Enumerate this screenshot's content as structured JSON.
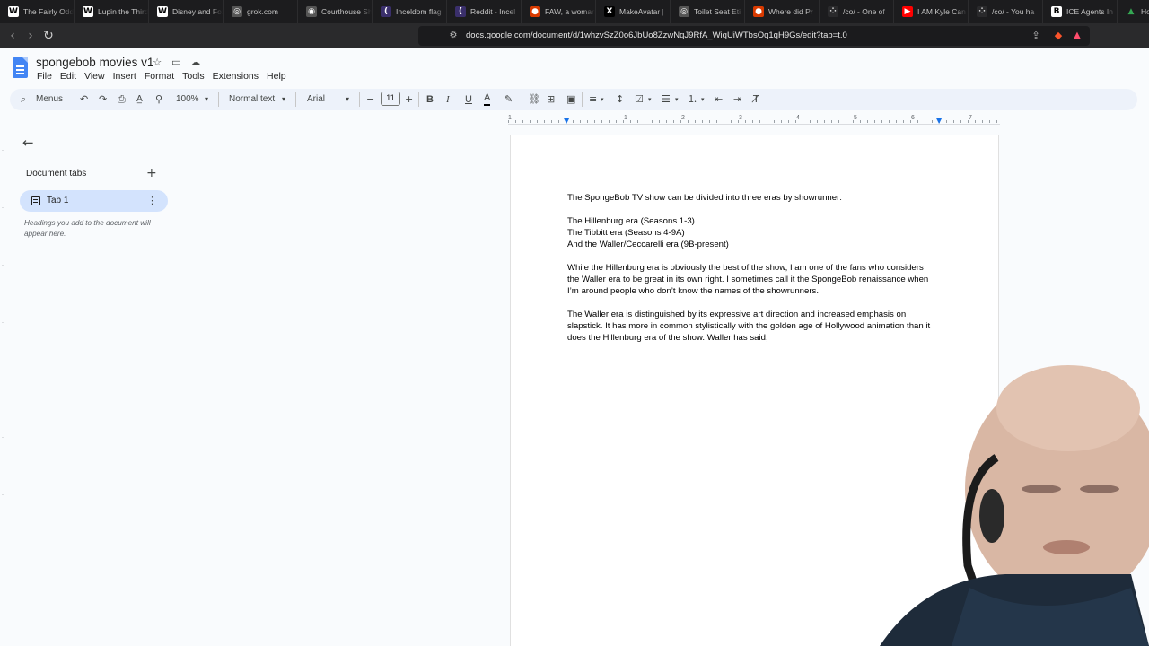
{
  "browser": {
    "tabs": [
      {
        "title": "The Fairly Odd",
        "icon": "wikipedia-icon",
        "color": "#ffffff",
        "glyph": "W"
      },
      {
        "title": "Lupin the Third",
        "icon": "wikipedia-icon",
        "color": "#ffffff",
        "glyph": "W"
      },
      {
        "title": "Disney and Fox",
        "icon": "wikipedia-icon",
        "color": "#ffffff",
        "glyph": "W"
      },
      {
        "title": "grok.com",
        "icon": "grok-icon",
        "color": "#555555",
        "glyph": "◎"
      },
      {
        "title": "Courthouse Sh",
        "icon": "wordpress-icon",
        "color": "#555555",
        "glyph": "◉"
      },
      {
        "title": "Inceldom flag",
        "icon": "incel-wiki-icon",
        "color": "#3a2f6b",
        "glyph": "("
      },
      {
        "title": "Reddit - Incel",
        "icon": "incel-wiki-icon",
        "color": "#3a2f6b",
        "glyph": "("
      },
      {
        "title": "FAW, a woman",
        "icon": "reddit-icon",
        "color": "#d93a00",
        "glyph": "●"
      },
      {
        "title": "MakeAvatar |",
        "icon": "x-icon",
        "color": "#000000",
        "glyph": "X"
      },
      {
        "title": "Toilet Seat Eti",
        "icon": "toilet-icon",
        "color": "#555555",
        "glyph": "◎"
      },
      {
        "title": "Where did Pr",
        "icon": "reddit-icon",
        "color": "#d93a00",
        "glyph": "●"
      },
      {
        "title": "/co/ - One of",
        "icon": "fourchan-icon",
        "color": "#2a2a2c",
        "glyph": "⁘"
      },
      {
        "title": "I AM Kyle Can",
        "icon": "youtube-icon",
        "color": "#ff0000",
        "glyph": "▶"
      },
      {
        "title": "/co/ - You ha",
        "icon": "fourchan-icon",
        "color": "#2a2a2c",
        "glyph": "⁘"
      },
      {
        "title": "ICE Agents In",
        "icon": "bbc-icon",
        "color": "#ffffff",
        "glyph": "B"
      },
      {
        "title": "Home",
        "icon": "google-drive-icon",
        "color": "#1c1c1e",
        "glyph": "▲"
      }
    ],
    "url": "docs.google.com/document/d/1whzvSzZ0o6JbUo8ZzwNqJ9RfA_WiqUiWTbsOq1qH9Gs/edit?tab=t.0"
  },
  "docs": {
    "title": "spongebob movies v1",
    "menu": [
      "File",
      "Edit",
      "View",
      "Insert",
      "Format",
      "Tools",
      "Extensions",
      "Help"
    ],
    "toolbar": {
      "menus_label": "Menus",
      "zoom": "100%",
      "style": "Normal text",
      "font": "Arial",
      "font_size": "11"
    },
    "ruler_numbers": [
      "1",
      "1",
      "2",
      "3",
      "4",
      "5",
      "6",
      "7"
    ],
    "sidebar": {
      "header": "Document tabs",
      "tab_label": "Tab 1",
      "hint": "Headings you add to the document will appear here."
    },
    "body": {
      "intro": "The SpongeBob TV show can be divided into three eras by showrunner:",
      "eras": [
        "The Hillenburg era (Seasons 1-3)",
        "The Tibbitt era (Seasons 4-9A)",
        "And the Waller/Ceccarelli era (9B-present)"
      ],
      "para1_lines": [
        "While the Hillenburg era is obviously the best of the show, I am one of the fans who considers",
        "the Waller era to be great in its own right. I sometimes call it the SpongeBob renaissance when",
        "I’m around people who don’t know the names of the showrunners."
      ],
      "para2_lines": [
        "The Waller era is distinguished by its expressive art direction and increased emphasis on",
        "slapstick. It has more in common stylistically with the golden age of Hollywood animation than it",
        "does the Hillenburg era of the show. Waller has said,"
      ]
    }
  }
}
